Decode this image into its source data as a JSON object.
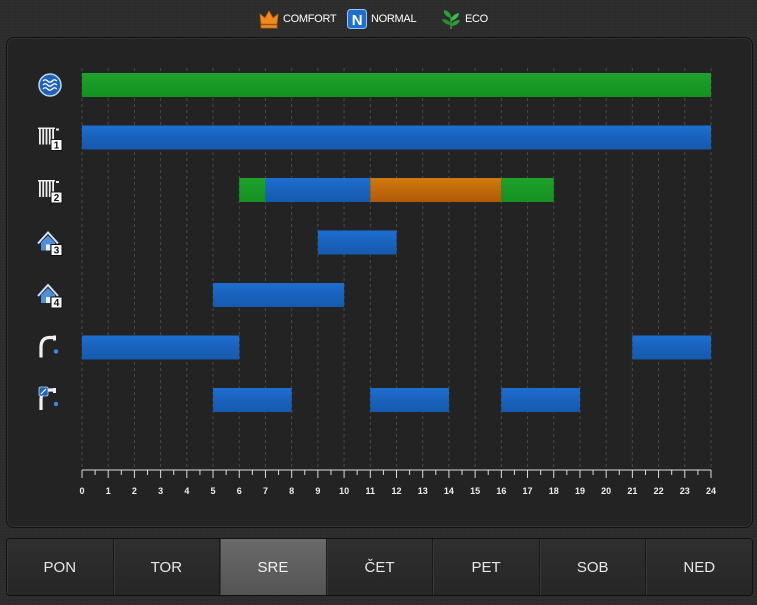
{
  "legend": {
    "comfort": {
      "label": "COMFORT",
      "color": "#f08a1e",
      "icon": "crown-icon"
    },
    "normal": {
      "label": "NORMAL",
      "color": "#1f6fd0",
      "icon": "n-badge-icon"
    },
    "eco": {
      "label": "ECO",
      "color": "#2aa035",
      "icon": "leaf-icon"
    }
  },
  "chart_data": {
    "type": "bar",
    "orientation": "horizontal-timeline",
    "x": [
      0,
      1,
      2,
      3,
      4,
      5,
      6,
      7,
      8,
      9,
      10,
      11,
      12,
      13,
      14,
      15,
      16,
      17,
      18,
      19,
      20,
      21,
      22,
      23,
      24
    ],
    "xlim": [
      0,
      24
    ],
    "grid": true,
    "rows": [
      {
        "icon": "water-tank-icon",
        "badge": "",
        "segments": [
          {
            "start": 0,
            "end": 24,
            "mode": "eco"
          }
        ]
      },
      {
        "icon": "radiator-icon",
        "badge": "1",
        "segments": [
          {
            "start": 0,
            "end": 24,
            "mode": "normal"
          }
        ]
      },
      {
        "icon": "radiator-icon",
        "badge": "2",
        "segments": [
          {
            "start": 6,
            "end": 7,
            "mode": "eco"
          },
          {
            "start": 7,
            "end": 11,
            "mode": "normal"
          },
          {
            "start": 11,
            "end": 16,
            "mode": "comfort"
          },
          {
            "start": 16,
            "end": 18,
            "mode": "eco"
          }
        ]
      },
      {
        "icon": "house-icon",
        "badge": "3",
        "segments": [
          {
            "start": 9,
            "end": 12,
            "mode": "normal"
          }
        ]
      },
      {
        "icon": "house-icon",
        "badge": "4",
        "segments": [
          {
            "start": 5,
            "end": 10,
            "mode": "normal"
          }
        ]
      },
      {
        "icon": "faucet-icon",
        "badge": "",
        "segments": [
          {
            "start": 0,
            "end": 6,
            "mode": "normal"
          },
          {
            "start": 21,
            "end": 24,
            "mode": "normal"
          }
        ]
      },
      {
        "icon": "faucet-circulation-icon",
        "badge": "",
        "segments": [
          {
            "start": 5,
            "end": 8,
            "mode": "normal"
          },
          {
            "start": 11,
            "end": 14,
            "mode": "normal"
          },
          {
            "start": 16,
            "end": 19,
            "mode": "normal"
          }
        ]
      }
    ]
  },
  "days": [
    {
      "label": "PON",
      "active": false
    },
    {
      "label": "TOR",
      "active": false
    },
    {
      "label": "SRE",
      "active": true
    },
    {
      "label": "ČET",
      "active": false
    },
    {
      "label": "PET",
      "active": false
    },
    {
      "label": "SOB",
      "active": false
    },
    {
      "label": "NED",
      "active": false
    }
  ]
}
